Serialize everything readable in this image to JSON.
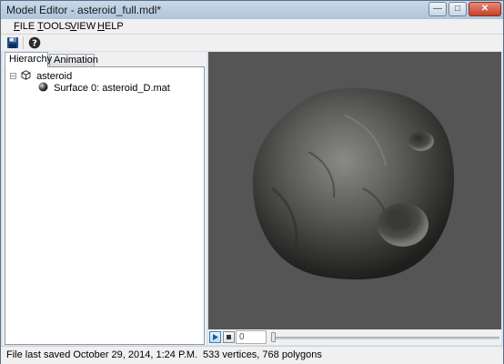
{
  "window": {
    "title": "Model Editor - asteroid_full.mdl*"
  },
  "menu": [
    {
      "label": "FILE",
      "accel": "F",
      "rest": "ILE"
    },
    {
      "label": "TOOLS",
      "accel": "T",
      "rest": "OOLS"
    },
    {
      "label": "VIEW",
      "accel": "V",
      "rest": "IEW"
    },
    {
      "label": "HELP",
      "accel": "H",
      "rest": "ELP"
    }
  ],
  "toolbar": {
    "save_icon": "save-icon",
    "help_icon": "help-icon"
  },
  "tabs": {
    "hierarchy": "Hierarchy",
    "animation": "Animation"
  },
  "tree": {
    "root_label": "asteroid",
    "child_label": "Surface 0: asteroid_D.mat"
  },
  "playback": {
    "frame": "0"
  },
  "status": {
    "saved": "File last saved October 29, 2014, 1:24 P.M.",
    "stats": "533 vertices, 768 polygons"
  },
  "colors": {
    "viewport_bg": "#555555",
    "window_frame": "#c8d9ea",
    "close_button": "#c4412b"
  }
}
